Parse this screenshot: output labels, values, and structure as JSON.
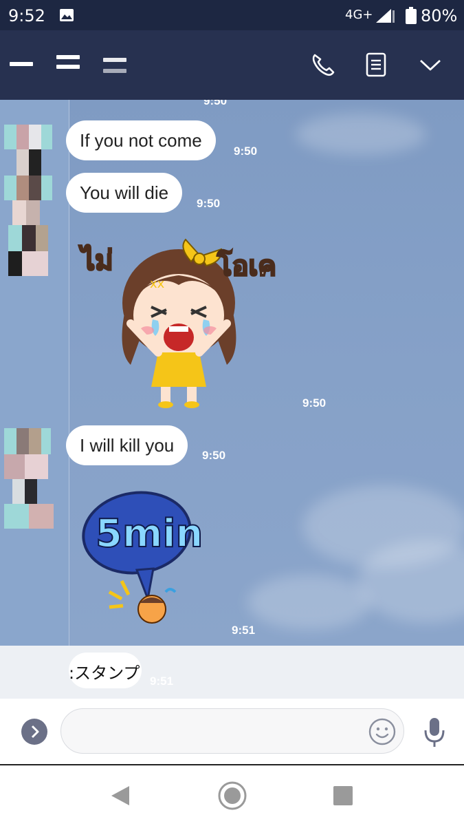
{
  "status_bar": {
    "time": "9:52",
    "network": "4G+",
    "battery": "80%",
    "icons": [
      "gallery-icon",
      "signal-icon",
      "battery-icon"
    ]
  },
  "header": {
    "icons": [
      "menu-bars-icon",
      "phone-icon",
      "notes-icon",
      "chevron-down-icon"
    ]
  },
  "chat": {
    "top_cut_time": "9:50",
    "messages": [
      {
        "type": "text",
        "text": "If you not come",
        "time": "9:50"
      },
      {
        "type": "text",
        "text": "You will die",
        "time": "9:50"
      },
      {
        "type": "sticker",
        "sticker_text_left": "ไม่",
        "sticker_text_right": "โอเค",
        "time": "9:50"
      },
      {
        "type": "text",
        "text": "I will kill you",
        "time": "9:50"
      },
      {
        "type": "sticker",
        "sticker_text": "5min",
        "time": "9:51"
      }
    ],
    "preview": {
      "text": ":スタンプ",
      "time": "9:51"
    }
  },
  "input_bar": {
    "placeholder": "",
    "icons": [
      "expand-arrow-icon",
      "emoji-icon",
      "microphone-icon"
    ]
  },
  "nav_bar": {
    "icons": [
      "back-icon",
      "home-icon",
      "recents-icon"
    ]
  },
  "colors": {
    "header": "#273150",
    "status_bar": "#1d2742",
    "chat_bg": "#86a1c8",
    "bubble": "#ffffff",
    "sticker_yellow": "#f5c518",
    "sticker_blue": "#2e4fb8"
  }
}
